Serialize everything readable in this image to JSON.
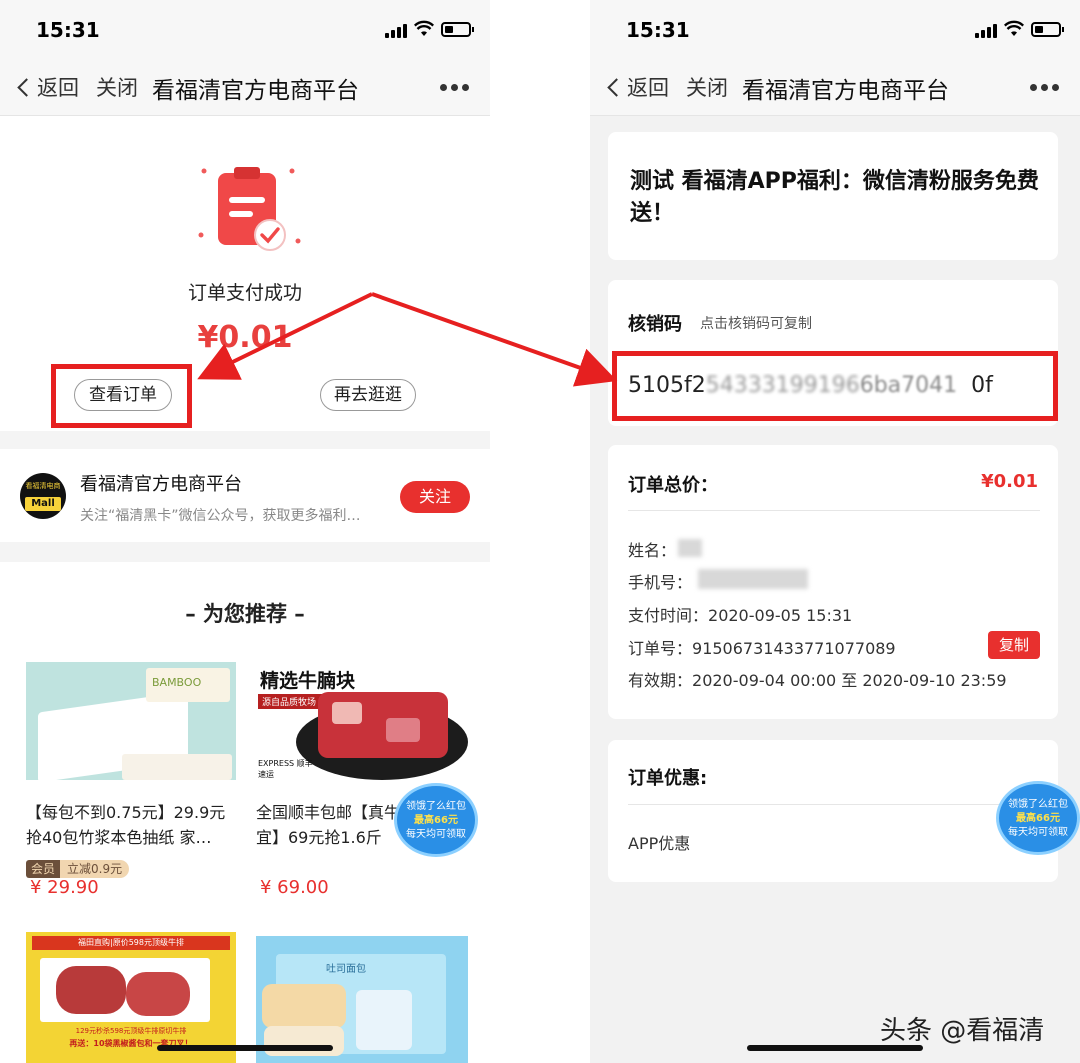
{
  "status_bar": {
    "time": "15:31"
  },
  "nav": {
    "back": "返回",
    "close": "关闭",
    "title": "看福清官方电商平台"
  },
  "left": {
    "pay_status": "订单支付成功",
    "amount": "¥0.01",
    "view_order": "查看订单",
    "shop_again": "再去逛逛",
    "shop": {
      "logo_top": "看福清电商",
      "logo_bottom": "Mall",
      "name": "看福清官方电商平台",
      "desc": "关注“福清黑卡”微信公众号，获取更多福利…",
      "follow": "关注"
    },
    "recommend_title": "– 为您推荐 –",
    "products": [
      {
        "title": "【每包不到0.75元】29.9元抢40包竹浆本色抽纸 家…",
        "member": "会员",
        "discount": "立减0.9元",
        "price": "¥ 29.90",
        "image_text": "BAMBOO"
      },
      {
        "title": "全国顺丰包邮【真牛便宜】69元抢1.6斤",
        "price": "¥ 69.00",
        "image_text": "精选牛腩块",
        "image_sub": "源自品质牧场 进口品质牛腩",
        "express": "EXPRESS 顺丰速运"
      },
      {
        "image_text": "福田直购|原价598元顶级牛排",
        "image_sub": "129元秒杀598元顶级牛排原切牛排",
        "image_sub2": "再送：10袋黑椒酱包和一套刀叉！"
      },
      {
        "image_text": "吐司面包"
      }
    ],
    "badge": {
      "line1": "领饿了么红包",
      "line2": "最高66元",
      "line3": "每天均可领取"
    }
  },
  "right": {
    "title": "测试 看福清APP福利：微信清粉服务免费送！",
    "code_label": "核销码",
    "code_hint": "点击核销码可复制",
    "code_value": "5105f2",
    "code_mid": "54333199196",
    "code_end": "6ba7041",
    "code_tail": "0f",
    "total_label": "订单总价：",
    "total_value": "¥0.01",
    "name_label": "姓名：",
    "phone_label": "手机号：",
    "pay_time_label": "支付时间：",
    "pay_time": "2020-09-05 15:31",
    "order_no_label": "订单号：",
    "order_no": "915067314337710770​89",
    "copy": "复制",
    "validity_label": "有效期：",
    "validity": "2020-09-04 00:00 至 2020-09-10 23:59",
    "discount_title": "订单优惠:",
    "discount_item": "APP优惠"
  },
  "watermark": "头条 @看福清",
  "colors": {
    "accent": "#e8302e",
    "highlight": "#e62020",
    "link_blue": "#2a8fe6"
  }
}
